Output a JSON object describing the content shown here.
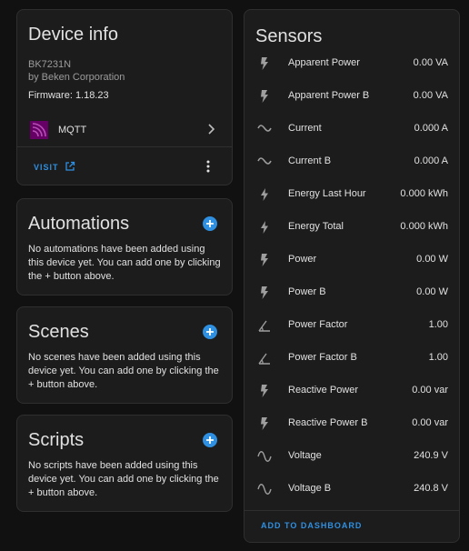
{
  "device_info": {
    "title": "Device info",
    "model": "BK7231N",
    "manufacturer": "by Beken Corporation",
    "firmware": "Firmware: 1.18.23",
    "integration_label": "MQTT",
    "visit_label": "VISIT"
  },
  "automations": {
    "title": "Automations",
    "description": "No automations have been added using this device yet. You can add one by clicking the + button above."
  },
  "scenes": {
    "title": "Scenes",
    "description": "No scenes have been added using this device yet. You can add one by clicking the + button above."
  },
  "scripts": {
    "title": "Scripts",
    "description": "No scripts have been added using this device yet. You can add one by clicking the + button above."
  },
  "sensors": {
    "title": "Sensors",
    "add_to_dashboard_label": "ADD TO DASHBOARD",
    "items": [
      {
        "name": "Apparent Power",
        "value": "0.00 VA",
        "icon": "flash-icon"
      },
      {
        "name": "Apparent Power B",
        "value": "0.00 VA",
        "icon": "flash-icon"
      },
      {
        "name": "Current",
        "value": "0.000 A",
        "icon": "current-ac-icon"
      },
      {
        "name": "Current B",
        "value": "0.000 A",
        "icon": "current-ac-icon"
      },
      {
        "name": "Energy Last Hour",
        "value": "0.000 kWh",
        "icon": "lightning-bolt-icon"
      },
      {
        "name": "Energy Total",
        "value": "0.000 kWh",
        "icon": "lightning-bolt-icon"
      },
      {
        "name": "Power",
        "value": "0.00 W",
        "icon": "flash-icon"
      },
      {
        "name": "Power B",
        "value": "0.00 W",
        "icon": "flash-icon"
      },
      {
        "name": "Power Factor",
        "value": "1.00",
        "icon": "angle-acute-icon"
      },
      {
        "name": "Power Factor B",
        "value": "1.00",
        "icon": "angle-acute-icon"
      },
      {
        "name": "Reactive Power",
        "value": "0.00 var",
        "icon": "flash-icon"
      },
      {
        "name": "Reactive Power B",
        "value": "0.00 var",
        "icon": "flash-icon"
      },
      {
        "name": "Voltage",
        "value": "240.9 V",
        "icon": "sine-wave-icon"
      },
      {
        "name": "Voltage B",
        "value": "240.8 V",
        "icon": "sine-wave-icon"
      }
    ]
  },
  "colors": {
    "accent": "#2f8fe0",
    "mqtt_brand": "#660066",
    "card_background": "#1c1c1c",
    "page_background": "#111111"
  }
}
